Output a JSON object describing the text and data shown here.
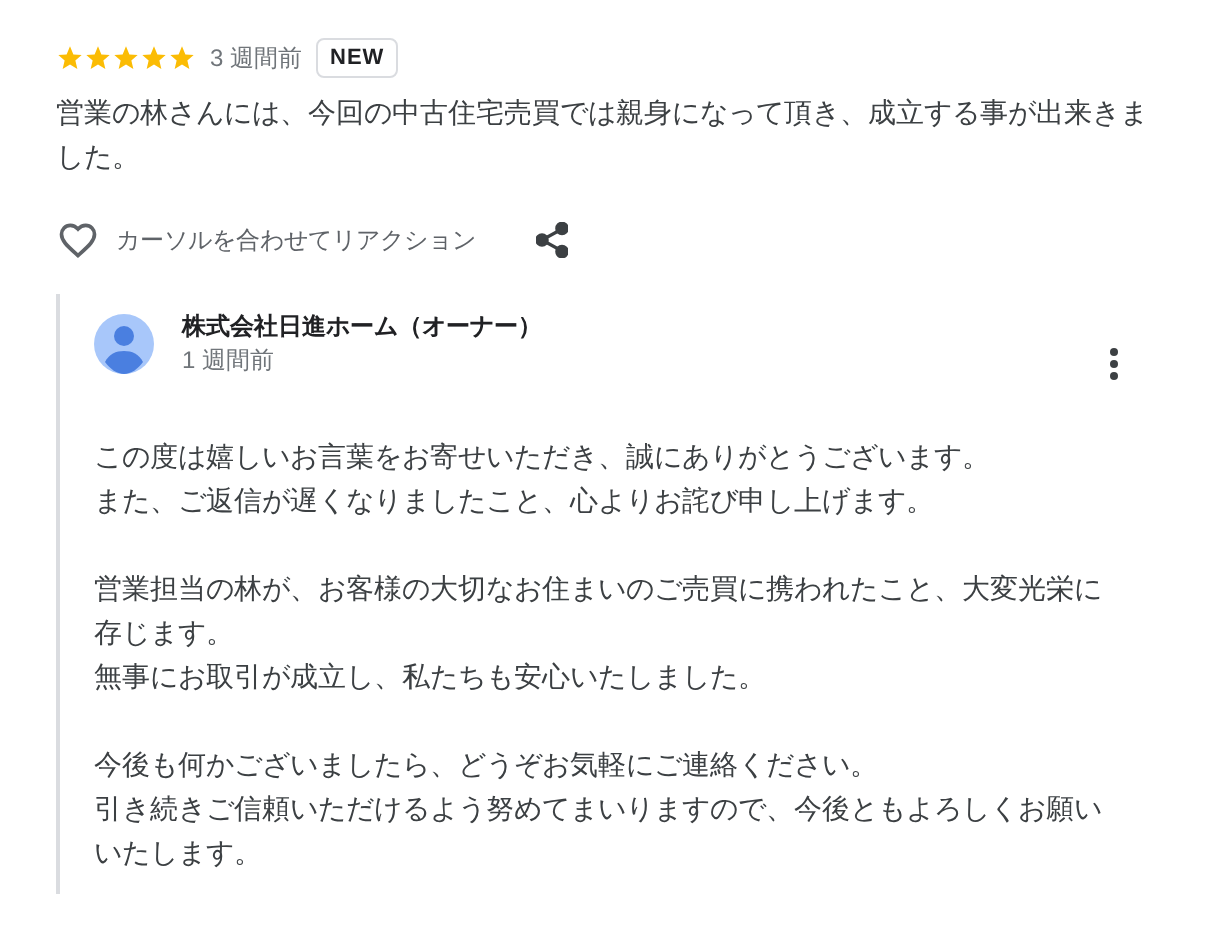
{
  "review": {
    "stars": 5,
    "time": "3 週間前",
    "badge": "NEW",
    "text": "営業の林さんには、今回の中古住宅売買では親身になって頂き、成立する事が出来きました。",
    "reaction_label": "カーソルを合わせてリアクション"
  },
  "reply": {
    "author": "株式会社日進ホーム（オーナー）",
    "time": "1 週間前",
    "paragraphs": [
      [
        "この度は嬉しいお言葉をお寄せいただき、誠にありがとうございます。",
        "また、ご返信が遅くなりましたこと、心よりお詫び申し上げます。"
      ],
      [
        "営業担当の林が、お客様の大切なお住まいのご売買に携われたこと、大変光栄に存じます。",
        "無事にお取引が成立し、私たちも安心いたしました。"
      ],
      [
        "今後も何かございましたら、どうぞお気軽にご連絡ください。",
        "引き続きご信頼いただけるよう努めてまいりますので、今後ともよろしくお願いいたします。"
      ]
    ]
  }
}
